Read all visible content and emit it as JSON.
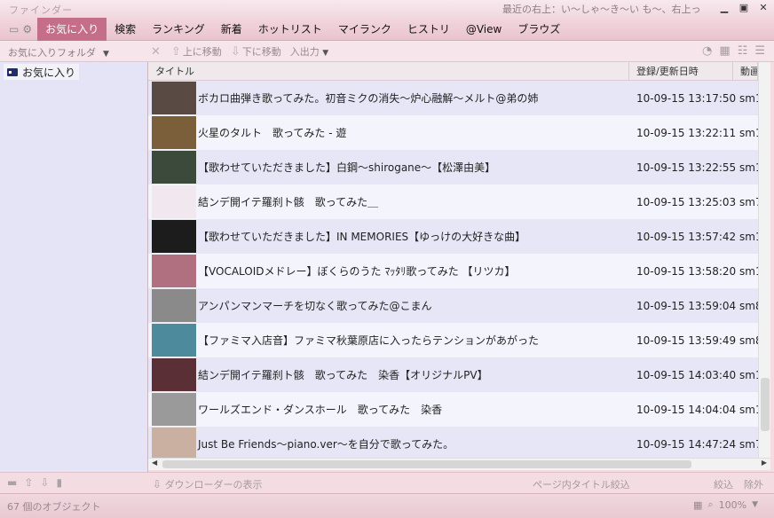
{
  "window": {
    "title": "ファインダー",
    "ticker": "最近の右上：い〜しゃ〜き〜い も〜、右上っ"
  },
  "menu": {
    "items": [
      "お気に入り",
      "検索",
      "ランキング",
      "新着",
      "ホットリスト",
      "マイランク",
      "ヒストリ",
      "@View",
      "ブラウズ"
    ],
    "active": "お気に入り"
  },
  "toolbar": {
    "folder_label": "お気に入りフォルダ",
    "move_up": "上に移動",
    "move_down": "下に移動",
    "io": "入出力"
  },
  "sidebar": {
    "folders": [
      {
        "label": "お気に入り"
      }
    ]
  },
  "list": {
    "columns": [
      "タイトル",
      "登録/更新日時",
      "動画"
    ],
    "rows": [
      {
        "title": "ボカロ曲弾き歌ってみた。初音ミクの消失〜炉心融解〜メルト@弟の姉",
        "date": "10-09-15 13:17:50",
        "id": "sm1",
        "thumb_color": "#5a4a44"
      },
      {
        "title": "火星のタルト　歌ってみた - 遊",
        "date": "10-09-15 13:22:11",
        "id": "sm1",
        "thumb_color": "#7a5f3a"
      },
      {
        "title": "【歌わせていただきました】白鋼～shirogane～【松澤由美】",
        "date": "10-09-15 13:22:55",
        "id": "sm1",
        "thumb_color": "#3c4a3c"
      },
      {
        "title": "結ンデ開イテ羅刹ト骸　歌ってみた＿",
        "date": "10-09-15 13:25:03",
        "id": "sm7",
        "thumb_color": "#f0e8ee"
      },
      {
        "title": "【歌わせていただきました】IN MEMORIES【ゆっけの大好きな曲】",
        "date": "10-09-15 13:57:42",
        "id": "sm1",
        "thumb_color": "#1c1c1c"
      },
      {
        "title": "【VOCALOIDメドレー】ぼくらのうた ﾏｯﾀﾘ歌ってみた 【リツカ】",
        "date": "10-09-15 13:58:20",
        "id": "sm1",
        "thumb_color": "#b07080"
      },
      {
        "title": "アンパンマンマーチを切なく歌ってみた@こまん",
        "date": "10-09-15 13:59:04",
        "id": "sm8",
        "thumb_color": "#8a8a8a"
      },
      {
        "title": "【ファミマ入店音】ファミマ秋葉原店に入ったらテンションがあがった",
        "date": "10-09-15 13:59:49",
        "id": "sm8",
        "thumb_color": "#4d8a9c"
      },
      {
        "title": "結ンデ開イテ羅刹ト骸　歌ってみた　染香【オリジナルPV】",
        "date": "10-09-15 14:03:40",
        "id": "sm1",
        "thumb_color": "#5a2f35"
      },
      {
        "title": "ワールズエンド・ダンスホール　歌ってみた　染香",
        "date": "10-09-15 14:04:04",
        "id": "sm1",
        "thumb_color": "#9a9a9a"
      },
      {
        "title": "Just Be Friends〜piano.ver〜を自分で歌ってみた。",
        "date": "10-09-15 14:47:24",
        "id": "sm7",
        "thumb_color": "#c9b0a0"
      }
    ]
  },
  "bottom": {
    "downloader": "ダウンローダーの表示",
    "page_filter": "ページ内タイトル絞込",
    "filter": "絞込",
    "clear": "除外"
  },
  "status": {
    "count": "67 個のオブジェクト",
    "zoom": "100%"
  }
}
